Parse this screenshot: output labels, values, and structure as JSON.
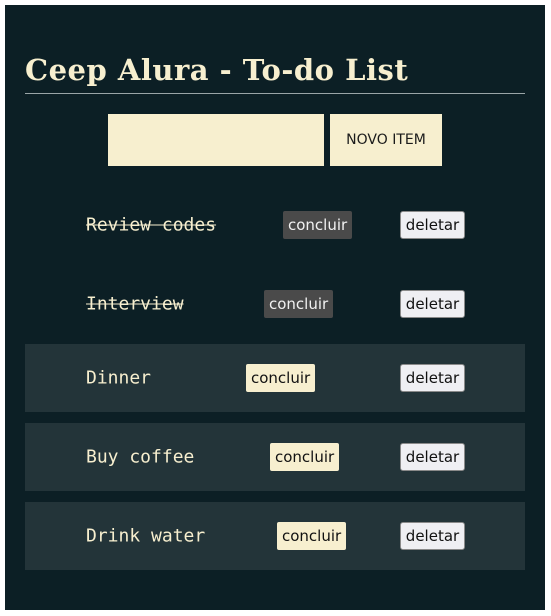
{
  "header": {
    "title": "Ceep Alura - To-do List"
  },
  "form": {
    "input_value": "",
    "submit_label": "NOVO ITEM"
  },
  "items": [
    {
      "text": "Review codes",
      "done": true,
      "complete_label": "concluir",
      "delete_label": "deletar"
    },
    {
      "text": "Interview",
      "done": true,
      "complete_label": "concluir",
      "delete_label": "deletar"
    },
    {
      "text": "Dinner",
      "done": false,
      "complete_label": "concluir",
      "delete_label": "deletar"
    },
    {
      "text": "Buy coffee",
      "done": false,
      "complete_label": "concluir",
      "delete_label": "deletar"
    },
    {
      "text": "Drink water",
      "done": false,
      "complete_label": "concluir",
      "delete_label": "deletar"
    }
  ],
  "colors": {
    "background": "#0c1f25",
    "accent": "#f7efcf",
    "open_item_bg": "#233439",
    "done_button_bg": "#4a4a4a"
  }
}
